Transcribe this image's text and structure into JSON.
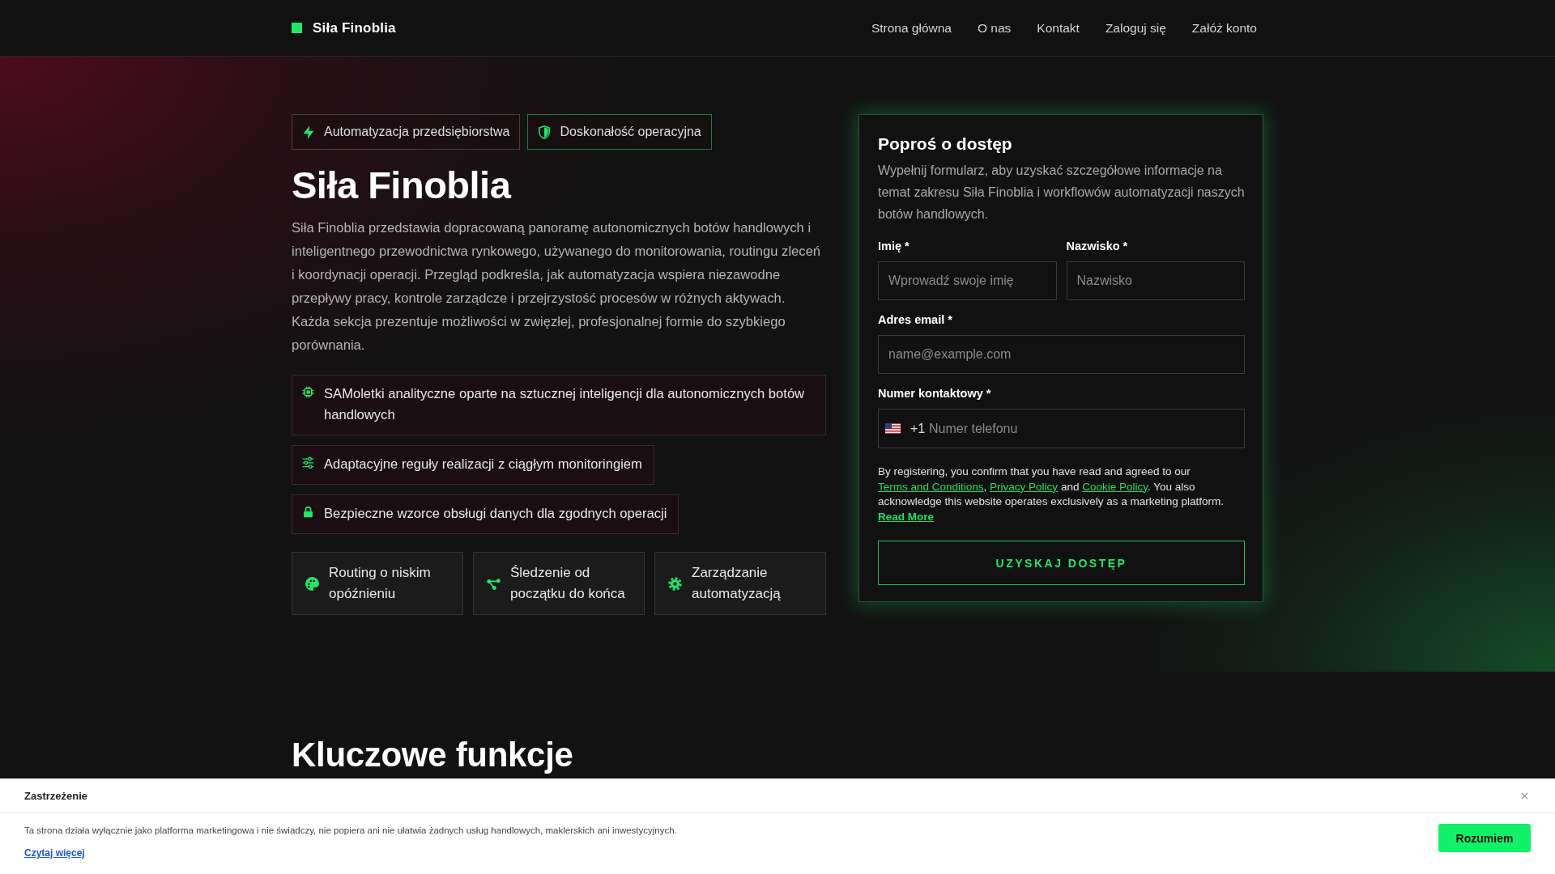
{
  "header": {
    "logo": "Siła Finoblia",
    "nav": [
      "Strona główna",
      "O nas",
      "Kontakt",
      "Zaloguj się",
      "Załóż konto"
    ]
  },
  "hero": {
    "badges": [
      {
        "label": "Automatyzacja przedsiębiorstwa",
        "kind": "lightning"
      },
      {
        "label": "Doskonałość operacyjna",
        "kind": "shield"
      }
    ],
    "title": "Siła Finoblia",
    "description": "Siła Finoblia przedstawia dopracowaną panoramę autonomicznych botów handlowych i inteligentnego przewodnictwa rynkowego, używanego do monitorowania, routingu zleceń i koordynacji operacji. Przegląd podkreśla, jak automatyzacja wspiera niezawodne przepływy pracy, kontrole zarządcze i przejrzystość procesów w różnych aktywach. Każda sekcja prezentuje możliwości w zwięzłej, profesjonalnej formie do szybkiego porównania.",
    "highlights": [
      "SAMoletki analityczne oparte na sztucznej inteligencji dla autonomicznych botów handlowych",
      "Adaptacyjne reguły realizacji z ciągłym monitoringiem",
      "Bezpieczne wzorce obsługi danych dla zgodnych operacji"
    ],
    "cards": [
      "Routing o niskim opóźnieniu",
      "Śledzenie od początku do końca",
      "Zarządzanie automatyzacją"
    ]
  },
  "form": {
    "title": "Poproś o dostęp",
    "description": "Wypełnij formularz, aby uzyskać szczegółowe informacje na temat zakresu Siła Finoblia i workflowów automatyzacji naszych botów handlowych.",
    "fields": [
      {
        "kind": "half",
        "label": "Imię *",
        "placeholder": "Wprowadź swoje imię"
      },
      {
        "kind": "half",
        "label": "Nazwisko *",
        "placeholder": "Nazwisko"
      },
      {
        "kind": "email",
        "label": "Adres email *",
        "placeholder": "name@example.com"
      },
      {
        "kind": "phone",
        "label": "Numer kontaktowy *",
        "dial_code": "+1",
        "placeholder": "Numer telefonu"
      }
    ],
    "consent": [
      {
        "kind": "text",
        "text": "By registering, you confirm that you have read and agreed to our "
      },
      {
        "kind": "link",
        "text": "Terms and Conditions"
      },
      {
        "kind": "text",
        "text": ", "
      },
      {
        "kind": "link",
        "text": "Privacy Policy"
      },
      {
        "kind": "text",
        "text": " and "
      },
      {
        "kind": "link",
        "text": "Cookie Policy"
      },
      {
        "kind": "text",
        "text": ". You also acknowledge this website operates exclusively as a marketing platform. "
      },
      {
        "kind": "strong_link",
        "text": "Read More"
      }
    ],
    "submit": "UZYSKAJ DOSTĘP"
  },
  "features_section": {
    "title": "Kluczowe funkcje"
  },
  "disclaimer": {
    "title": "Zastrzeżenie",
    "text": "Ta strona działa wyłącznie jako platforma marketingowa i nie świadczy, nie popiera ani nie ułatwia żadnych usług handlowych, maklerskich ani inwestycyjnych.",
    "link": "Czytaj więcej",
    "button": "Rozumiem"
  }
}
